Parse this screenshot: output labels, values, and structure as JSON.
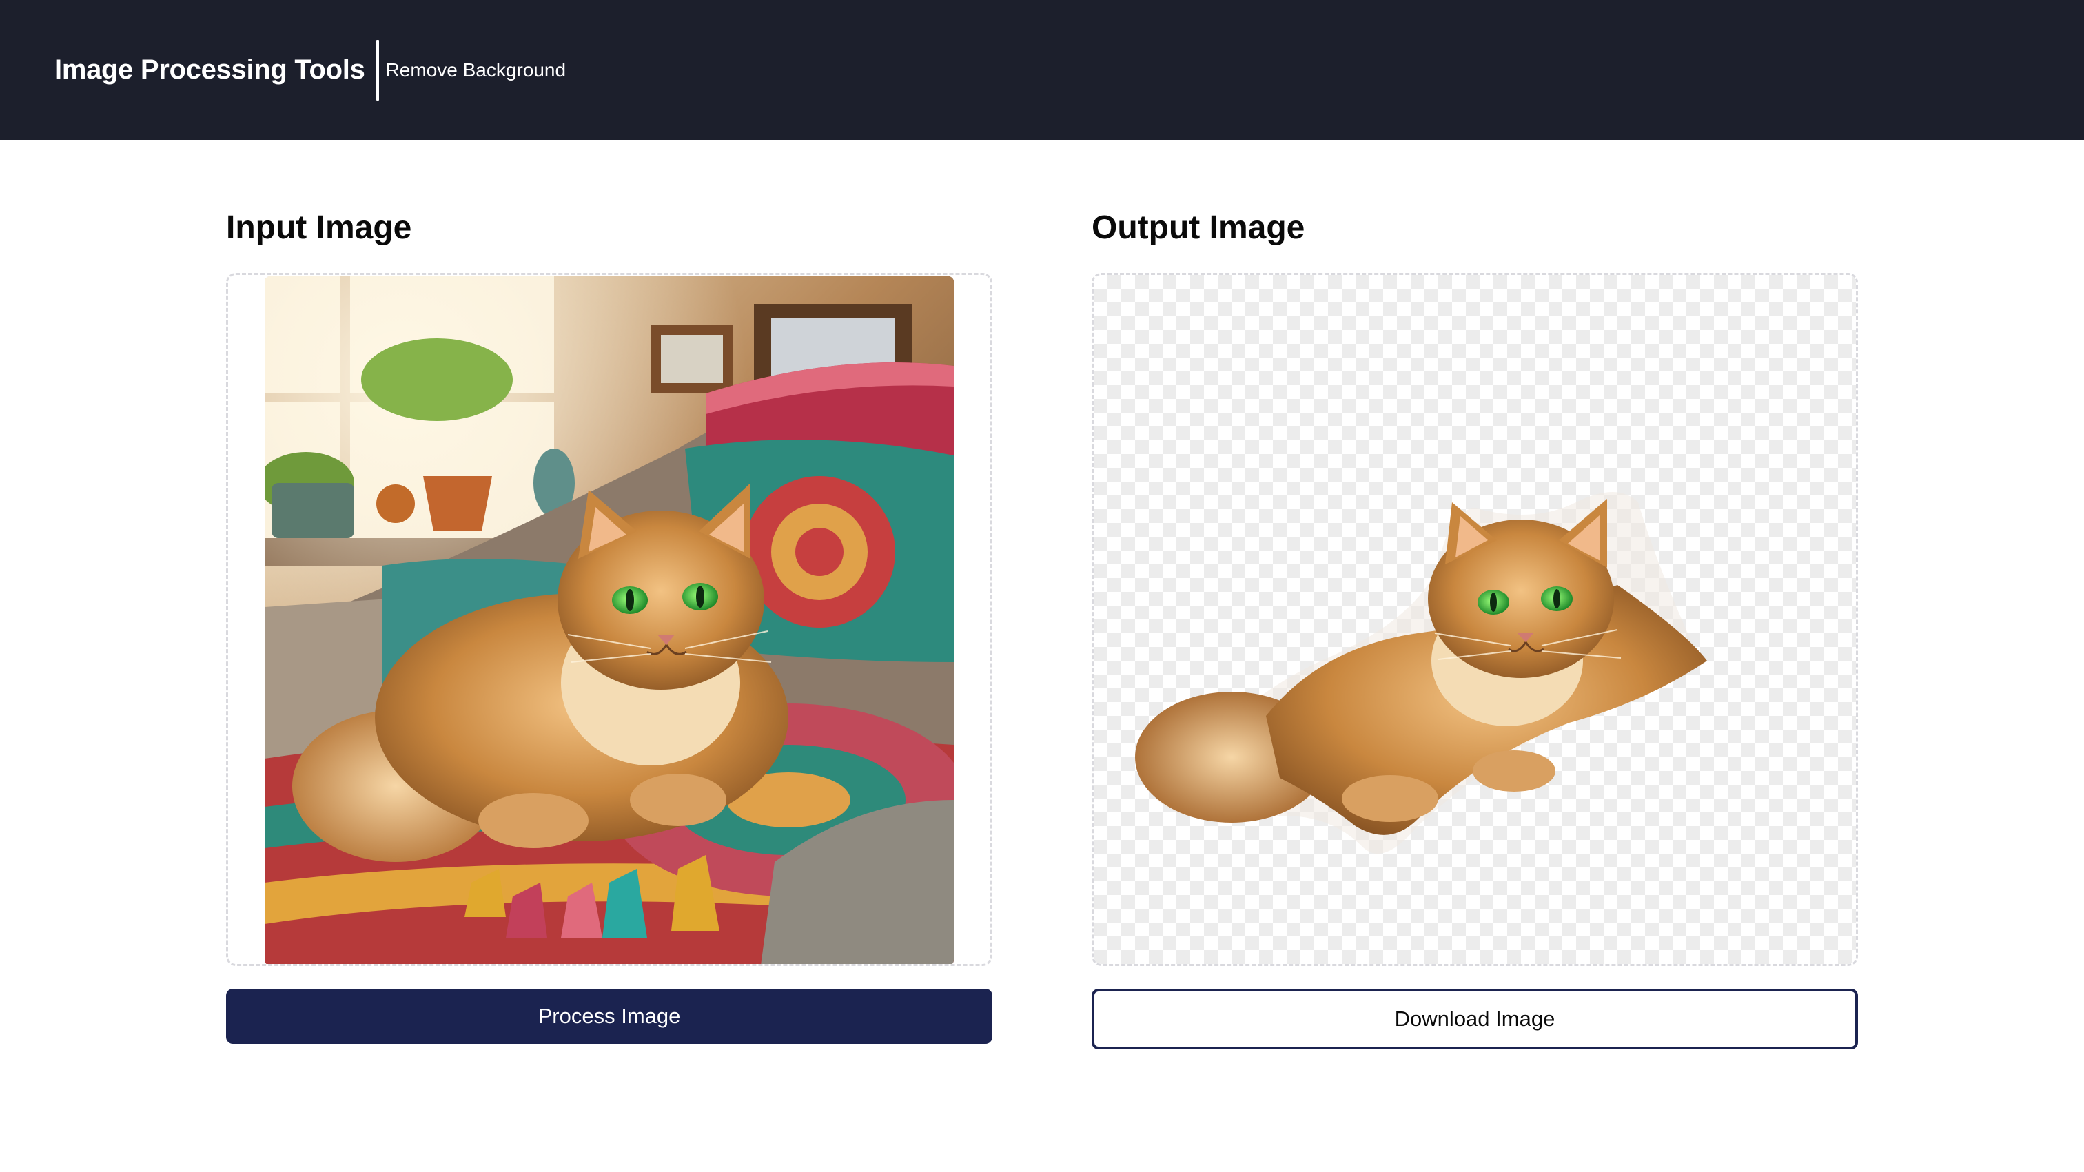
{
  "header": {
    "brand": "Image Processing Tools",
    "nav_link": "Remove Background"
  },
  "input_panel": {
    "title": "Input Image",
    "image_alt": "Fluffy orange cat with green eyes lying on colorful knitted pillows on a sofa by a sunny window",
    "button_label": "Process Image"
  },
  "output_panel": {
    "title": "Output Image",
    "image_alt": "Cat cut out with background removed on transparent checkerboard",
    "button_label": "Download Image"
  },
  "colors": {
    "header_bg": "#1c1f2c",
    "primary_button": "#1b2350",
    "frame_border": "#d9d9de"
  }
}
